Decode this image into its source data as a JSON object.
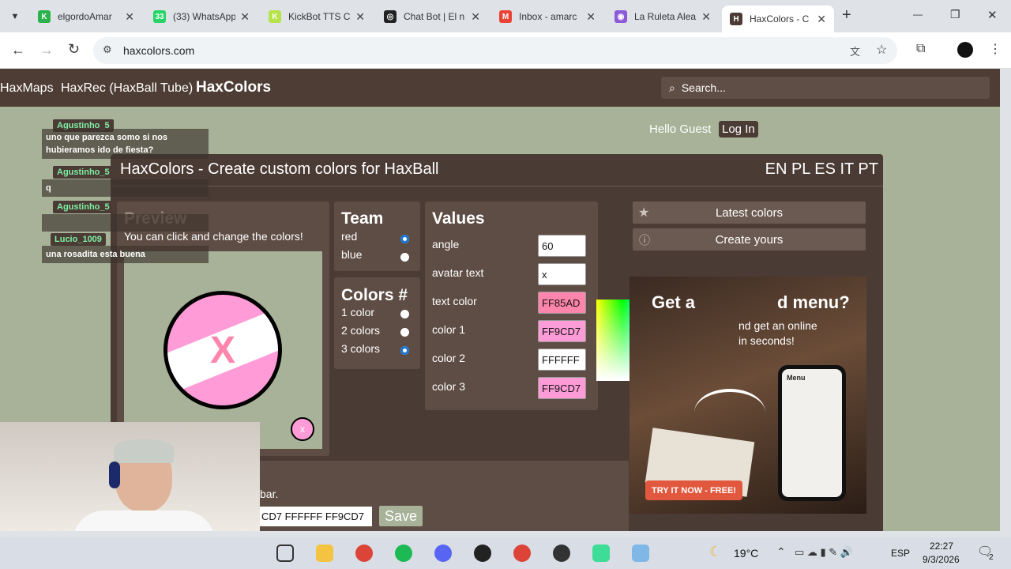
{
  "browser": {
    "tabs": [
      {
        "title": "elgordoAmar",
        "color": "#2bb24c",
        "glyph": "K"
      },
      {
        "title": "(33) WhatsApp",
        "color": "#25d366",
        "glyph": "33"
      },
      {
        "title": "KickBot TTS C",
        "color": "#b7e34a",
        "glyph": "K"
      },
      {
        "title": "Chat Bot | El n",
        "color": "#222222",
        "glyph": "◎"
      },
      {
        "title": "Inbox - amarc",
        "color": "#ea4335",
        "glyph": "M"
      },
      {
        "title": "La Ruleta Alea",
        "color": "#8e5bd8",
        "glyph": "◉"
      },
      {
        "title": "HaxColors - C",
        "color": "#4b3b35",
        "glyph": "H"
      }
    ],
    "url": "haxcolors.com",
    "new_tab": "+",
    "window_min": "—",
    "window_restore": "❐",
    "window_close": "✕"
  },
  "site": {
    "nav": [
      "HaxMaps",
      "HaxRec (HaxBall Tube)",
      "HaxColors"
    ],
    "search_placeholder": "Search...",
    "greeting": "Hello Guest",
    "login": "Log In",
    "title": "HaxColors - Create custom colors for HaxBall",
    "languages": "EN PL ES IT PT",
    "preview_title": "Preview",
    "preview_hint": "You can click and change the colors!",
    "avatar_text": "X",
    "small_avatar_text": "x",
    "team": {
      "title": "Team",
      "options": [
        {
          "label": "red",
          "selected": true
        },
        {
          "label": "blue",
          "selected": false
        }
      ]
    },
    "colors_count": {
      "title": "Colors #",
      "options": [
        {
          "label": "1 color",
          "selected": false
        },
        {
          "label": "2 colors",
          "selected": false
        },
        {
          "label": "3 colors",
          "selected": true
        }
      ]
    },
    "values": {
      "title": "Values",
      "rows": [
        {
          "label": "angle",
          "value": "60",
          "bg": "#ffffff"
        },
        {
          "label": "avatar text",
          "value": "x",
          "bg": "#ffffff"
        },
        {
          "label": "text color",
          "value": "FF85AD",
          "bg": "#ff85ad"
        },
        {
          "label": "color 1",
          "value": "FF9CD7",
          "bg": "#ff9cd7"
        },
        {
          "label": "color 2",
          "value": "FFFFFF",
          "bg": "#ffffff"
        },
        {
          "label": "color 3",
          "value": "FF9CD7",
          "bg": "#ff9cd7"
        }
      ]
    },
    "latest_colors": "Latest colors",
    "create_yours": "Create yours",
    "ad": {
      "headline_left": "Get a",
      "headline_right": "d menu?",
      "sub1": "nd get an online",
      "sub2": "in seconds!",
      "phone_menu": "Menu",
      "cta": "TRY IT NOW - FREE!"
    },
    "bottom_text": "bar.",
    "command_value": "CD7 FFFFFF FF9CD7",
    "save": "Save"
  },
  "chat": [
    {
      "name": "Agustinho_5",
      "message": "uno que parezca somo si nos hubieramos ido de fiesta?"
    },
    {
      "name": "Agustinho_5",
      "message": "q"
    },
    {
      "name": "Agustinho_5",
      "message": ""
    },
    {
      "name": "Lucio_1009",
      "message": "una rosadita esta buena"
    }
  ],
  "taskbar": {
    "temperature": "19°C",
    "language": "ESP",
    "time": "22:27",
    "date": "9/3/2026",
    "notifications": "2"
  },
  "colors": {
    "accent_blue": "#1a76d2",
    "pink": "#ff9cd7",
    "site_brown": "#4b3b35"
  }
}
